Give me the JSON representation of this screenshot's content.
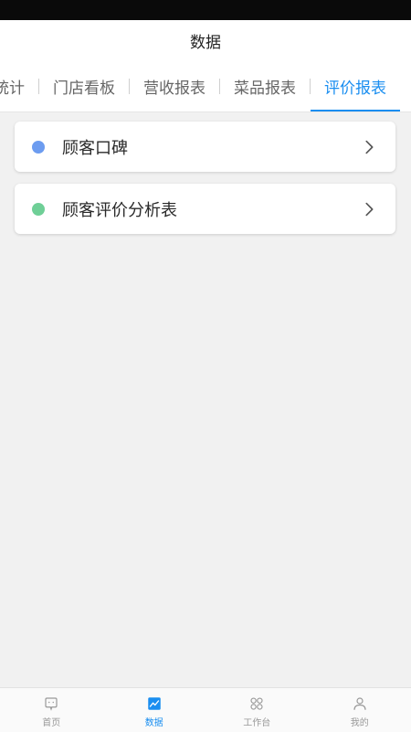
{
  "header": {
    "title": "数据"
  },
  "tabs": [
    {
      "label": "统计",
      "active": false
    },
    {
      "label": "门店看板",
      "active": false
    },
    {
      "label": "营收报表",
      "active": false
    },
    {
      "label": "菜品报表",
      "active": false
    },
    {
      "label": "评价报表",
      "active": true
    }
  ],
  "cards": [
    {
      "label": "顾客口碑",
      "dot_color": "#6c9cf0",
      "icon": "chevron-right-icon"
    },
    {
      "label": "顾客评价分析表",
      "dot_color": "#6fcf97",
      "icon": "chevron-right-icon"
    }
  ],
  "bottom_nav": [
    {
      "label": "首页",
      "icon": "home-icon",
      "active": false
    },
    {
      "label": "数据",
      "icon": "chart-icon",
      "active": true
    },
    {
      "label": "工作台",
      "icon": "grid-icon",
      "active": false
    },
    {
      "label": "我的",
      "icon": "user-icon",
      "active": false
    }
  ],
  "colors": {
    "accent": "#1a8ef0",
    "background": "#f1f1f1"
  }
}
